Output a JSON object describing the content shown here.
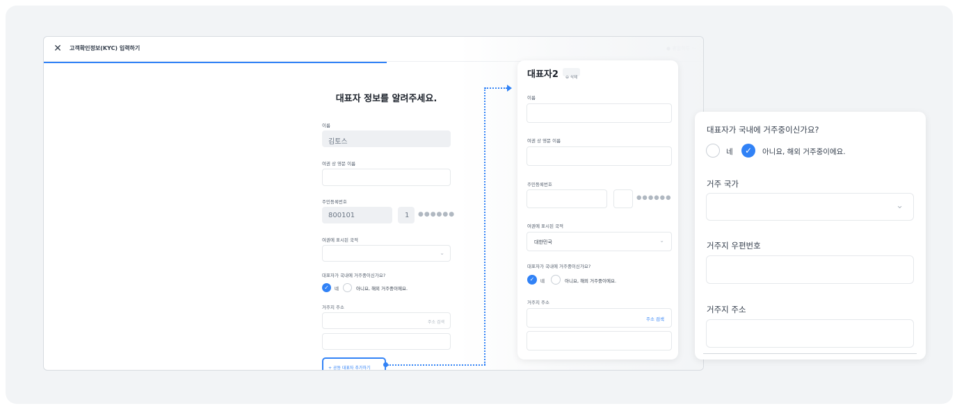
{
  "modal": {
    "title": "고객확인정보(KYC) 입력하기",
    "right_faded": "● 휴일하루 ···",
    "progress": 0.52
  },
  "form": {
    "heading": "대표자 정보를 알려주세요.",
    "name_label": "이름",
    "name_value": "김토스",
    "passport_name_label": "여권 상 영문 이름",
    "rrn_label": "주민등록번호",
    "rrn_front": "800101",
    "rrn_back_first": "1",
    "rrn_mask": "●●●●●●",
    "nationality_label": "여권에 표시된 국적",
    "residence_question": "대표자가 국내에 거주중이신가요?",
    "yes": "네",
    "no": "아니요, 해외 거주중이에요.",
    "address_label": "거주지 주소",
    "address_search": "주소 검색",
    "add_rep_button": "+ 공동 대표자 추가하기"
  },
  "card2": {
    "title": "대표자2",
    "delete_badge": "삭제",
    "name_label": "이름",
    "passport_name_label": "여권 상 영문 이름",
    "rrn_label": "주민등록번호",
    "rrn_mask": "●●●●●●",
    "nationality_label": "여권에 표시된 국적",
    "nationality_value": "대한민국",
    "residence_question": "대표자가 국내에 거주중이신가요?",
    "yes": "네",
    "no": "아니요, 해외 거주중이에요.",
    "address_label": "거주지 주소",
    "address_search": "주소 검색"
  },
  "card3": {
    "residence_question": "대표자가 국내에 거주중이신가요?",
    "yes": "네",
    "no": "아니요, 해외 거주중이에요.",
    "country_label": "거주 국가",
    "zip_label": "거주지 우편번호",
    "address_label": "거주지 주소"
  },
  "colors": {
    "accent": "#3182f6",
    "background": "#f2f4f6",
    "text": "#191f28"
  }
}
